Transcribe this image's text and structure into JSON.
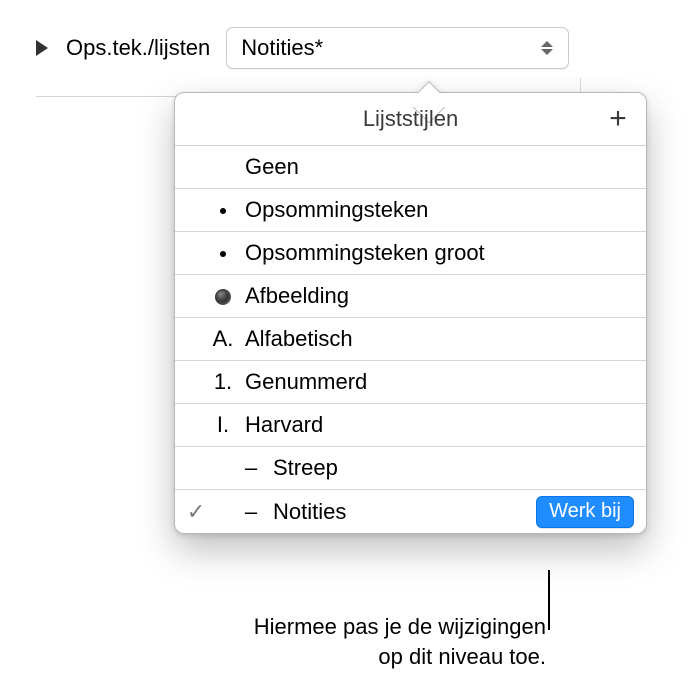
{
  "inspector": {
    "section_label": "Ops.tek./lijsten",
    "popup_value": "Notities*"
  },
  "popover": {
    "title": "Lijststijlen",
    "add_glyph": "+",
    "items": [
      {
        "leading": "",
        "leading_kind": "none",
        "label": "Geen",
        "indent": false,
        "checked": false
      },
      {
        "leading": "",
        "leading_kind": "dot",
        "label": "Opsommingsteken",
        "indent": false,
        "checked": false
      },
      {
        "leading": "",
        "leading_kind": "dot",
        "label": "Opsommingsteken groot",
        "indent": false,
        "checked": false
      },
      {
        "leading": "",
        "leading_kind": "bigdot",
        "label": "Afbeelding",
        "indent": false,
        "checked": false
      },
      {
        "leading": "A.",
        "leading_kind": "text",
        "label": "Alfabetisch",
        "indent": false,
        "checked": false
      },
      {
        "leading": "1.",
        "leading_kind": "text",
        "label": "Genummerd",
        "indent": false,
        "checked": false
      },
      {
        "leading": "I.",
        "leading_kind": "text",
        "label": "Harvard",
        "indent": false,
        "checked": false
      },
      {
        "leading": "",
        "leading_kind": "dash",
        "label": "Streep",
        "indent": true,
        "checked": false
      },
      {
        "leading": "",
        "leading_kind": "dash",
        "label": "Notities",
        "indent": true,
        "checked": true,
        "update_label": "Werk bij"
      }
    ],
    "check_glyph": "✓"
  },
  "callout": {
    "line1": "Hiermee pas je de wijzigingen",
    "line2": "op dit niveau toe."
  }
}
